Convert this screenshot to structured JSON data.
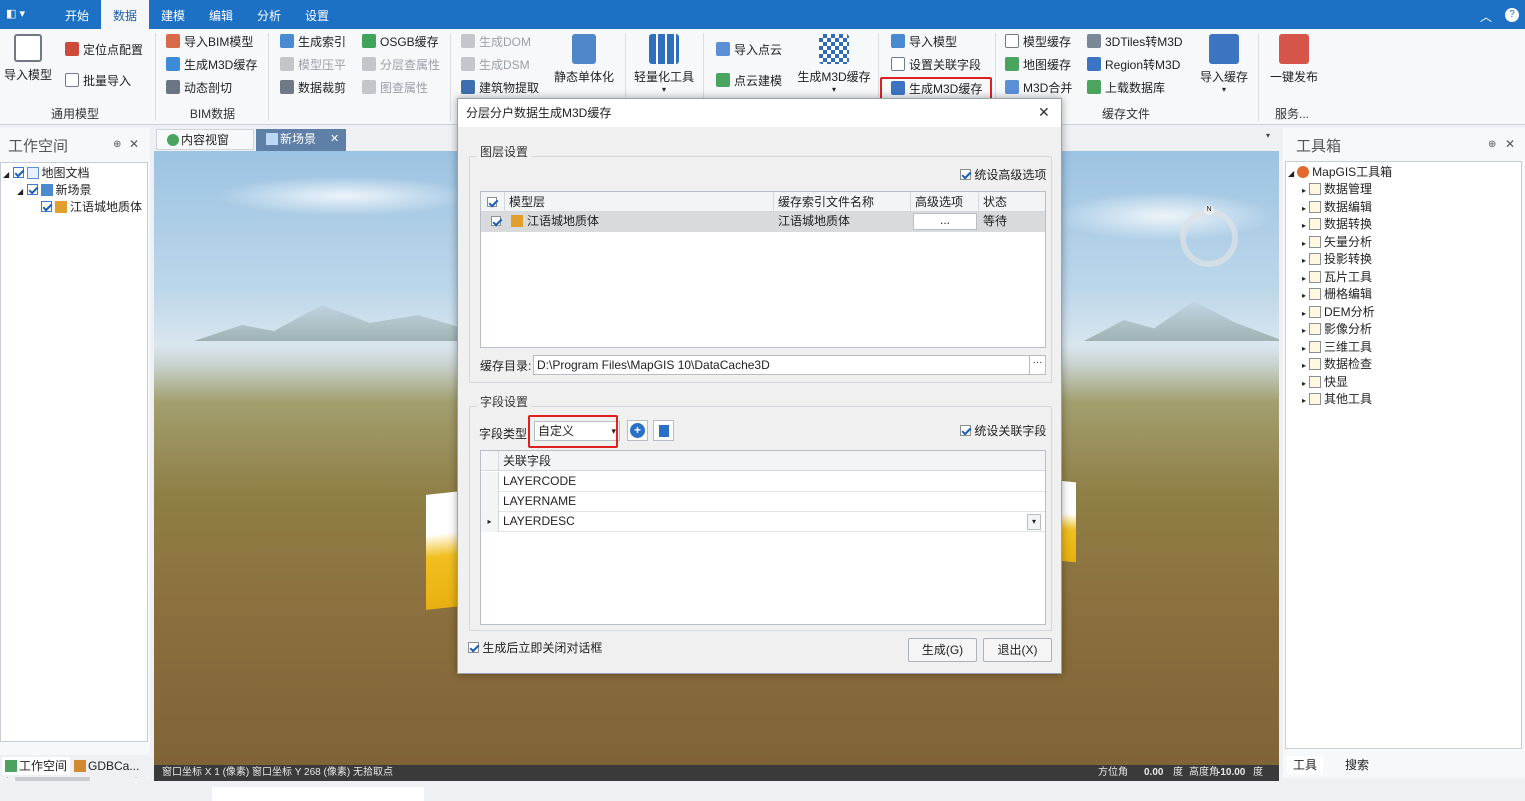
{
  "menubar": {
    "app_button": "◧ ▾",
    "tabs": [
      "开始",
      "数据",
      "建模",
      "编辑",
      "分析",
      "设置"
    ],
    "collapse_icon": "chevron-up-icon",
    "help_icon": "help-icon"
  },
  "ribbon": {
    "groups": [
      {
        "label": "通用模型",
        "big": [
          "导入模型"
        ],
        "items": [
          "定位点配置",
          "批量导入"
        ]
      },
      {
        "label": "BIM数据",
        "items": [
          "导入BIM模型",
          "生成M3D缓存",
          "动态剖切"
        ]
      },
      {
        "items": [
          "生成索引",
          "模型压平",
          "数据裁剪",
          "OSGB缓存",
          "分层查属性",
          "图查属性"
        ]
      },
      {
        "items": [
          "生成DOM",
          "生成DSM",
          "建筑物提取"
        ],
        "big": [
          "静态单体化"
        ]
      },
      {
        "big": [
          "轻量化工具"
        ]
      },
      {
        "items": [
          "导入点云",
          "点云建模"
        ],
        "big": [
          "生成M3D缓存"
        ]
      },
      {
        "items": [
          "导入模型",
          "设置关联字段",
          "生成M3D缓存"
        ]
      },
      {
        "label": "缓存文件",
        "items": [
          "模型缓存",
          "地图缓存",
          "M3D合并",
          "3DTiles转M3D",
          "Region转M3D",
          "上载数据库"
        ],
        "big": [
          "导入缓存"
        ]
      },
      {
        "label": "服务...",
        "big": [
          "一键发布"
        ]
      }
    ],
    "partial_label": "模"
  },
  "workspace": {
    "title": "工作空间",
    "tree": [
      "地图文档",
      "新场景",
      "江语城地质体"
    ],
    "bottom_tabs": [
      "工作空间",
      "GDBCa..."
    ]
  },
  "doc_tabs": [
    "内容视窗",
    "新场景"
  ],
  "toolbox": {
    "title": "工具箱",
    "root": "MapGIS工具箱",
    "items": [
      "数据管理",
      "数据编辑",
      "数据转换",
      "矢量分析",
      "投影转换",
      "瓦片工具",
      "栅格编辑",
      "DEM分析",
      "影像分析",
      "三维工具",
      "数据检查",
      "快显",
      "其他工具"
    ],
    "bottom_tabs": [
      "工具",
      "搜索"
    ]
  },
  "status": {
    "left": "窗口坐标 X 1    (像素) 窗口坐标 Y 268 (像素) 无拾取点",
    "azimuth_label": "方位角",
    "azimuth": "0.00",
    "deg1": "度",
    "elev_label": "高度角",
    "elev": "-10.00",
    "deg2": "度"
  },
  "dialog": {
    "title": "分层分户数据生成M3D缓存",
    "layer_section": "图层设置",
    "advanced_option": "统设高级选项",
    "columns": [
      "模型层",
      "缓存索引文件名称",
      "高级选项",
      "状态"
    ],
    "row": {
      "layer": "江语城地质体",
      "index": "江语城地质体",
      "adv": "...",
      "state": "等待"
    },
    "cache_dir_label": "缓存目录:",
    "cache_dir": "D:\\Program Files\\MapGIS 10\\DataCache3D",
    "field_section": "字段设置",
    "field_type_label": "字段类型:",
    "field_type_value": "自定义",
    "unified_field": "统设关联字段",
    "field_column": "关联字段",
    "fields": [
      "LAYERCODE",
      "LAYERNAME",
      "LAYERDESC"
    ],
    "close_after": "生成后立即关闭对话框",
    "generate_btn": "生成(G)",
    "exit_btn": "退出(X)"
  }
}
